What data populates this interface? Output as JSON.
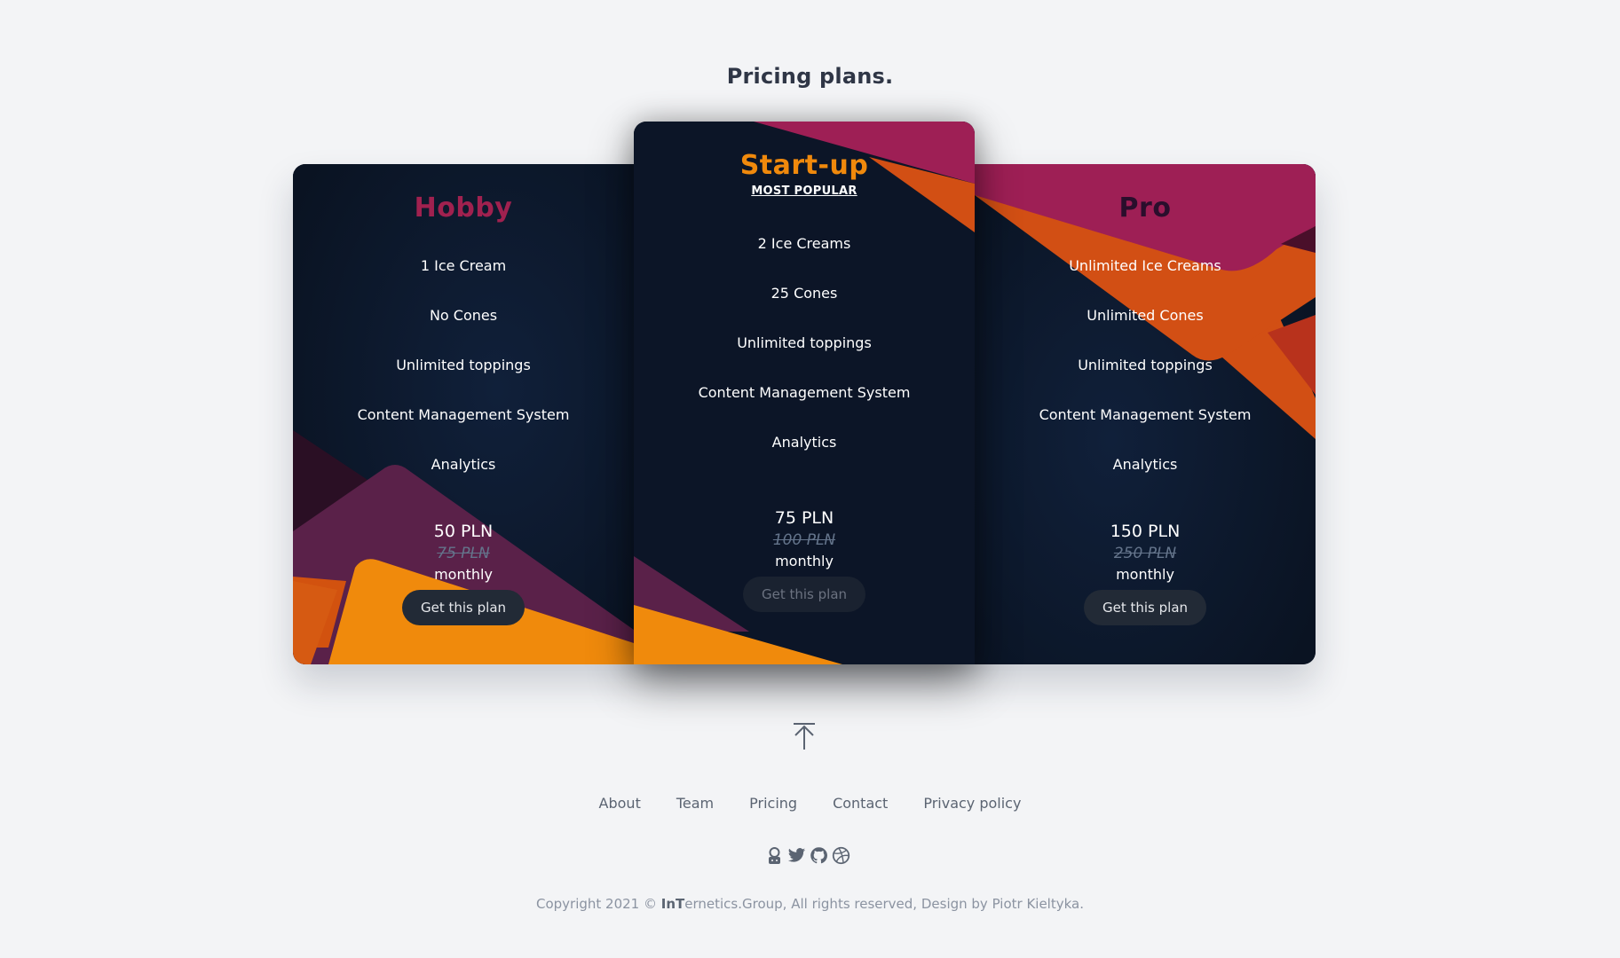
{
  "section": {
    "title": "Pricing plans."
  },
  "plans": [
    {
      "name": "Hobby",
      "features": [
        "1 Ice Cream",
        "No Cones",
        "Unlimited toppings",
        "Content Management System",
        "Analytics"
      ],
      "price": "50 PLN",
      "old_price": "75 PLN",
      "period": "monthly",
      "button": "Get this plan",
      "name_color": "#a0214f"
    },
    {
      "name": "Start-up",
      "badge": "MOST POPULAR",
      "features": [
        "2 Ice Creams",
        "25 Cones",
        "Unlimited toppings",
        "Content Management System",
        "Analytics"
      ],
      "price": "75 PLN",
      "old_price": "100 PLN",
      "period": "monthly",
      "button": "Get this plan",
      "name_color": "#f0890c"
    },
    {
      "name": "Pro",
      "features": [
        "Unlimited Ice Creams",
        "Unlimited Cones",
        "Unlimited toppings",
        "Content Management System",
        "Analytics"
      ],
      "price": "150 PLN",
      "old_price": "250 PLN",
      "period": "monthly",
      "button": "Get this plan",
      "name_color": "#2a0e2c"
    }
  ],
  "footer": {
    "scroll_top_icon": "arrow-up-to-line-icon",
    "nav": [
      "About",
      "Team",
      "Pricing",
      "Contact",
      "Privacy policy"
    ],
    "social_icons": [
      "keybase-icon",
      "twitter-icon",
      "github-icon",
      "dribbble-icon"
    ],
    "copyright_prefix": "Copyright 2021 © ",
    "copyright_brand": "InT",
    "copyright_suffix": "ernetics.Group, All rights reserved, Design by Piotr Kieltyka."
  },
  "colors": {
    "background": "#f3f4f6",
    "card": "#0d1628",
    "magenta": "#a0214f",
    "orange": "#f0890c",
    "dark_orange": "#d24f14",
    "plum": "#5a2149"
  }
}
